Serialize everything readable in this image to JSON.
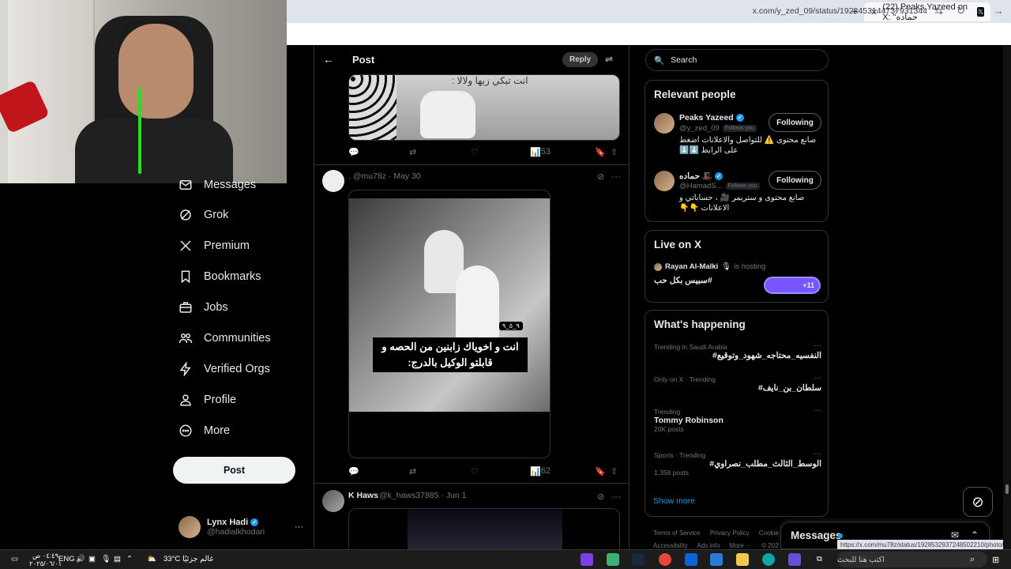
{
  "browser": {
    "tab_title": "(22) Peaks Yazeed on X: \"حماده",
    "url": "x.com/y_zed_09/status/1928453144737931344",
    "status_url": "https://x.com/mu78z/status/1928532937248502210/photo/1"
  },
  "nav": {
    "items": [
      {
        "label": "Messages"
      },
      {
        "label": "Grok"
      },
      {
        "label": "Premium"
      },
      {
        "label": "Bookmarks"
      },
      {
        "label": "Jobs"
      },
      {
        "label": "Communities"
      },
      {
        "label": "Verified Orgs"
      },
      {
        "label": "Profile"
      },
      {
        "label": "More"
      }
    ],
    "post_button": "Post",
    "account": {
      "name": "Lynx Hadi",
      "handle": "@hadialkhodari",
      "more": "···"
    }
  },
  "header": {
    "title": "Post",
    "reply": "Reply"
  },
  "posts": [
    {
      "caption": "انت تبكي زيها ولالا :",
      "views": "53"
    },
    {
      "meta": ". @mu78z · May 30",
      "time_badge": "٩_٥_٩",
      "subtitle": "انت و اخوياك زابنين من الحصه و قابلتو الوكيل بالدرج:",
      "views": "62"
    },
    {
      "name": "K Haws",
      "meta": "@k_haws37885 · Jun 1"
    }
  ],
  "sidebar": {
    "search_placeholder": "Search",
    "relevant_title": "Relevant people",
    "people": [
      {
        "name": "Peaks Yazeed",
        "handle": "@y_zed_09",
        "follows_you": "Follows you",
        "bio": "صانع محتوى ⚠️ للتواصل والاعلانات اضغط على الرابط ⬇️⬇️",
        "button": "Following"
      },
      {
        "name": "حماده 🎩",
        "handle": "@HamadS...",
        "follows_you": "Follows you",
        "bio": "صانع محتوى و ستريمر 🎥 ، حساباتي و الاعلانات 👇👇",
        "button": "Following"
      }
    ],
    "live": {
      "title": "Live on X",
      "host": "Rayan Al-Malki",
      "hosting": "is hosting",
      "space_title": "#سبيس بكل حب",
      "count": "+11"
    },
    "happening_title": "What's happening",
    "trends": [
      {
        "context": "Trending in Saudi Arabia",
        "name": "#النفسيه_محتاجه_شهود_وتوقيع",
        "count": ""
      },
      {
        "context": "Only on X · Trending",
        "name": "#سلطان_بن_نايف",
        "count": ""
      },
      {
        "context": "Trending",
        "name": "Tommy Robinson",
        "count": "20K posts"
      },
      {
        "context": "Sports · Trending",
        "name": "#الوسط_الثالث_مطلب_نصراوي",
        "count": "1,358 posts"
      }
    ],
    "show_more": "Show more",
    "footer": [
      "Terms of Service",
      "Privacy Policy",
      "Cookie P",
      "Accessibility",
      "Ads info",
      "More ···",
      "© 202"
    ],
    "messages_title": "Messages"
  },
  "taskbar": {
    "time": "٠٤:٤٩ ص",
    "date": "٢٠٢٥/٠٦/٠١",
    "lang": "ENG",
    "weather": "33°C",
    "weather_label": "غالم جزئيًا",
    "search_placeholder": "اكتب هنا للبحث"
  }
}
